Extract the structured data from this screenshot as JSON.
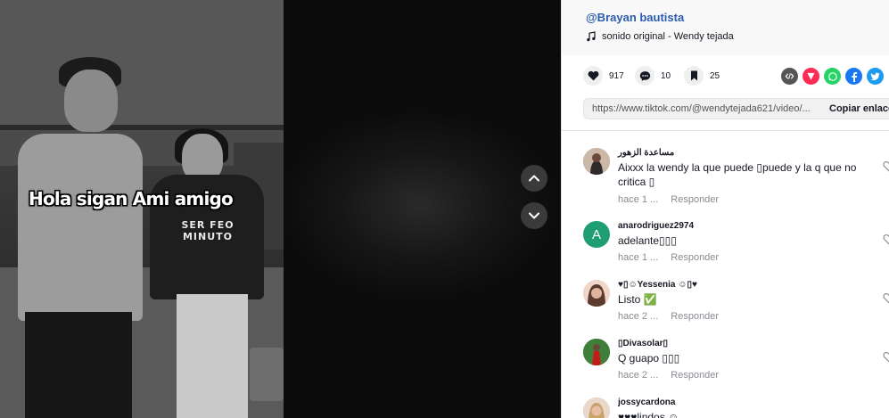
{
  "video": {
    "caption": "Hola sigan Ami amigo",
    "shirt_text": [
      "SER FEO",
      "MINUTO"
    ]
  },
  "author": {
    "handle": "@Brayan bautista",
    "music": "sonido original - Wendy tejada"
  },
  "stats": {
    "likes": "917",
    "comments": "10",
    "saves": "25"
  },
  "share": {
    "url": "https://www.tiktok.com/@wendytejada621/video/...",
    "copy_label": "Copiar enlace"
  },
  "comments": [
    {
      "user": "مساعدة الزهور",
      "text": "Aixxx la wendy la que puede ▯puede y la q que no critica ▯",
      "time": "hace 1 ...",
      "reply": "Responder"
    },
    {
      "user": "anarodriguez2974",
      "text": "adelante▯▯▯",
      "time": "hace 1 ...",
      "reply": "Responder",
      "initial": "A"
    },
    {
      "user": "♥▯☺Yessenia ☺▯♥",
      "text": "Listo ✅",
      "time": "hace 2 ...",
      "reply": "Responder"
    },
    {
      "user": "▯Divasolar▯",
      "text": "Q guapo ▯▯▯",
      "time": "hace 2 ...",
      "reply": "Responder"
    },
    {
      "user": "jossycardona",
      "text": "♥♥♥lindos ☺",
      "time": "",
      "reply": ""
    }
  ],
  "colors": {
    "author": "#2b5cad",
    "avatar_a": "#1e9e72",
    "share_embed": "#555555",
    "share_send": "#fe2c55",
    "share_whatsapp": "#25d366",
    "share_facebook": "#1877f2",
    "share_twitter": "#1d9bf0"
  }
}
